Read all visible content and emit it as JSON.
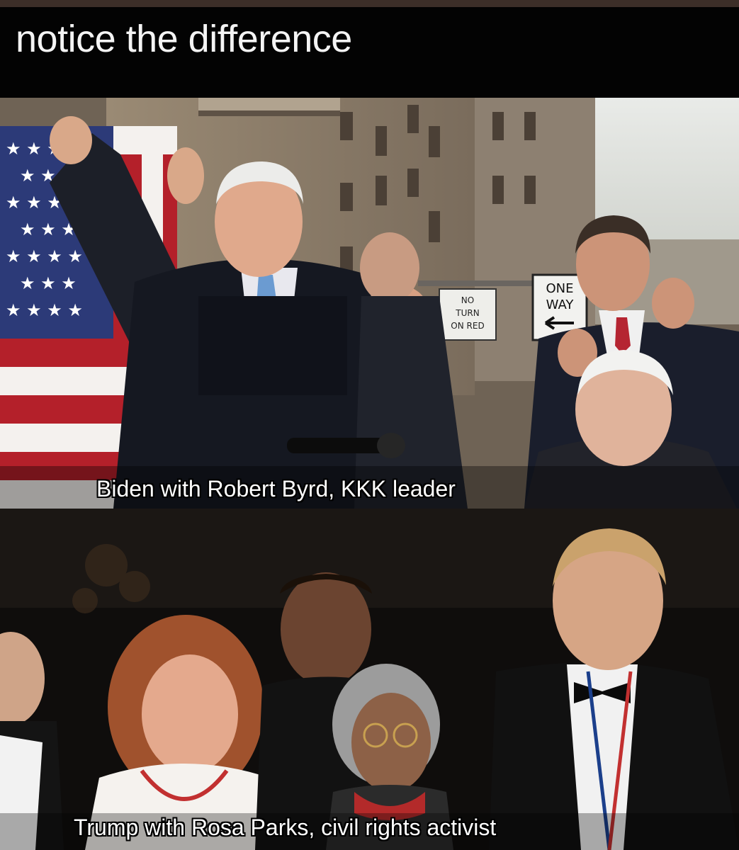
{
  "meme": {
    "title": "notice the difference",
    "top_caption": "Biden with Robert Byrd, KKK leader",
    "bottom_caption": "Trump with Rosa Parks, civil rights activist"
  },
  "signs": {
    "no_turn": [
      "NO",
      "TURN",
      "ON RED"
    ],
    "one_way": [
      "ONE",
      "WAY"
    ]
  }
}
